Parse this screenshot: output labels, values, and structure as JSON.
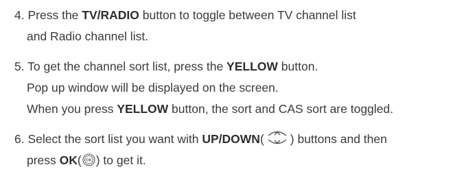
{
  "items": [
    {
      "number": "4.",
      "line1": {
        "pre": "Press the ",
        "bold": "TV/RADIO",
        "post": " button to toggle between TV channel list"
      },
      "line2": "and Radio channel list."
    },
    {
      "number": "5.",
      "line1": {
        "pre": "To get the channel sort list, press the ",
        "bold": "YELLOW",
        "post": " button."
      },
      "line2": "Pop up window will be displayed on the screen.",
      "line3": {
        "pre": "When you press ",
        "bold": "YELLOW",
        "post": " button, the sort and CAS sort are toggled."
      }
    },
    {
      "number": "6.",
      "line1": {
        "pre": "Select the sort list you want with ",
        "bold": "UP/DOWN",
        "open": "(",
        "close": ")",
        "post": " buttons and then"
      },
      "line2": {
        "pre": "press ",
        "bold": "OK",
        "open": "(",
        "close": ")",
        "post": " to get it."
      },
      "ok_icon_label": "OK"
    }
  ],
  "icons": [
    "up-down-buttons-icon",
    "ok-button-icon"
  ],
  "colors": {
    "text": "#3a3a3a",
    "bold": "#2e2e2e",
    "icon": "#555555"
  }
}
